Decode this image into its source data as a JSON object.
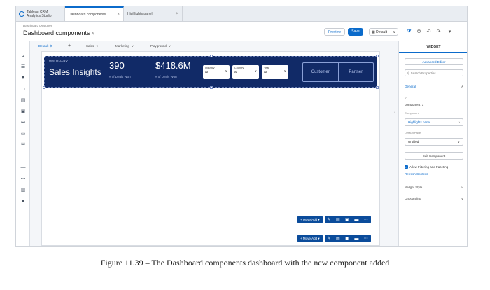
{
  "app": {
    "brand_line1": "Tableau CRM",
    "brand_line2": "Analytics Studio"
  },
  "tabs": [
    {
      "label": "Dashboard components",
      "close": "×"
    },
    {
      "label": "Highlights panel",
      "close": "×"
    }
  ],
  "header": {
    "breadcrumb": "Dashboard Designer",
    "title": "Dashboard components",
    "preview_label": "Preview",
    "save_label": "Save",
    "layout_label": "Default",
    "layout_chevron": "∨"
  },
  "page_tabs": {
    "default_label": "Default",
    "add_label": "+",
    "items": [
      {
        "label": "Sales",
        "chevron": "∨"
      },
      {
        "label": "Marketing",
        "chevron": "∨"
      },
      {
        "label": "Playground",
        "chevron": "∨"
      }
    ]
  },
  "highlights_panel": {
    "logo": "VISIONARY",
    "title": "Sales Insights",
    "kpis": [
      {
        "value": "390",
        "label": "# of Deals Won"
      },
      {
        "value": "$418.6M",
        "label": "# of Deals Won"
      }
    ],
    "filters": [
      {
        "label": "Industry",
        "value": "All"
      },
      {
        "label": "Country",
        "value": "All"
      },
      {
        "label": "Year",
        "value": "All"
      }
    ],
    "buttons": [
      "Customer",
      "Partner"
    ]
  },
  "float_toolbars": [
    {
      "move_label": "+ Move/Add ▾"
    },
    {
      "move_label": "+ Move/Add ▾"
    }
  ],
  "right_panel": {
    "header": "WIDGET",
    "advanced_editor": "Advanced Editor",
    "search_placeholder": "Search Properties...",
    "section_general": "General",
    "id_label": "ID",
    "id_value": "component_1",
    "component_label": "Component",
    "component_value": "Highlights panel",
    "default_page_label": "Default Page",
    "default_page_value": "Untitled",
    "edit_component": "Edit Component",
    "allow_filtering": "Allow Filtering and Faceting",
    "refresh_content": "Refresh Content",
    "section_widget_style": "Widget Style",
    "section_onboarding": "Onboarding"
  },
  "caption": "Figure 11.39 – The Dashboard components dashboard with the new component added",
  "colors": {
    "accent": "#0b6bcb",
    "panel_bg": "#112a67"
  }
}
